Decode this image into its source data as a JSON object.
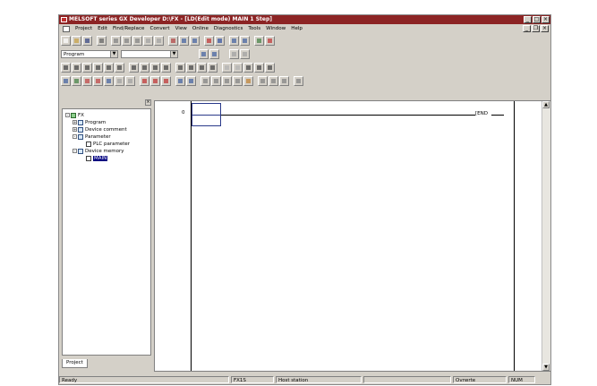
{
  "window": {
    "title": "MELSOFT series GX Developer D:\\FX - [LD(Edit mode)   MAIN   1 Step]",
    "minimize": "_",
    "maximize": "□",
    "close": "×"
  },
  "menubar": {
    "items": [
      "Project",
      "Edit",
      "Find/Replace",
      "Convert",
      "View",
      "Online",
      "Diagnostics",
      "Tools",
      "Window",
      "Help"
    ],
    "mdi_minimize": "_",
    "mdi_restore": "❐",
    "mdi_close": "×"
  },
  "toolbar": {
    "data_combo": "Program",
    "second_combo": ""
  },
  "project_panel": {
    "close": "×",
    "tree": [
      {
        "label": "FX",
        "expand": "-",
        "icon": "project-icon"
      },
      {
        "label": "Program",
        "expand": "+",
        "icon": "program-folder-icon"
      },
      {
        "label": "Device comment",
        "expand": "+",
        "icon": "comment-folder-icon"
      },
      {
        "label": "Parameter",
        "expand": "-",
        "icon": "parameter-folder-icon"
      },
      {
        "label": "PLC parameter",
        "expand": "",
        "icon": "document-icon"
      },
      {
        "label": "Device memory",
        "expand": "-",
        "icon": "device-memory-folder-icon"
      },
      {
        "label": "MAIN",
        "expand": "",
        "icon": "document-icon",
        "selected": true
      }
    ],
    "tab": "Project"
  },
  "ladder": {
    "step": "0",
    "end_instruction": "[END",
    "scroll_up": "▲",
    "scroll_down": "▼"
  },
  "statusbar": {
    "ready": "Ready",
    "plc_type": "FX1S",
    "station": "Host station",
    "mode": "Ovrwrte",
    "num": "NUM"
  }
}
